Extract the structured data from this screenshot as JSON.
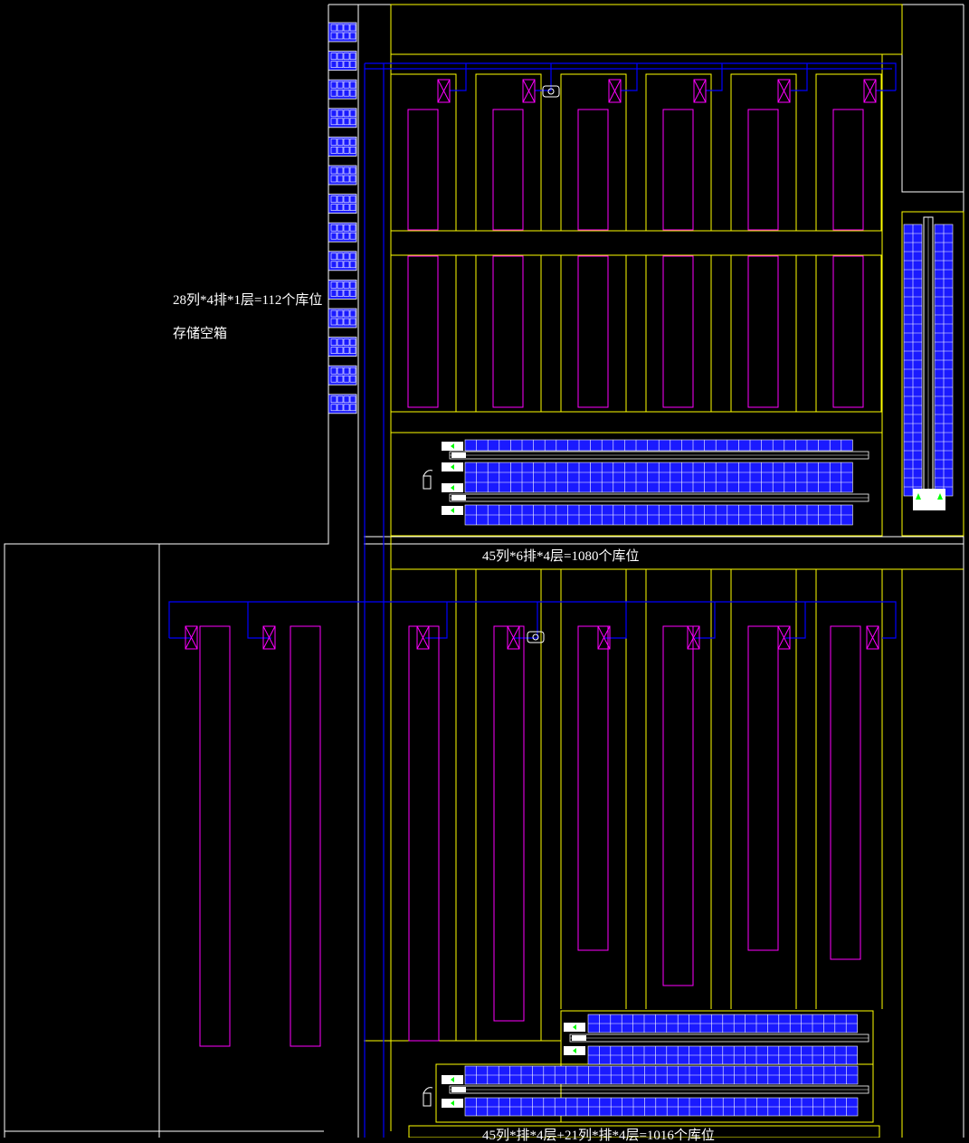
{
  "labels": {
    "small_rack_capacity": "28列*4排*1层=112个库位",
    "small_rack_purpose": "存储空箱",
    "main_rack_capacity": "45列*6排*4层=1080个库位",
    "bottom_rack_capacity": "45列*排*4层+21列*排*4层=1016个库位"
  },
  "colors": {
    "background": "#000000",
    "wall": "#ffffff",
    "zone": "#ffff00",
    "conveyor": "#0000ff",
    "machine": "#ff00ff",
    "rack_cell": "#1a1aff",
    "indicator": "#00ff00"
  }
}
